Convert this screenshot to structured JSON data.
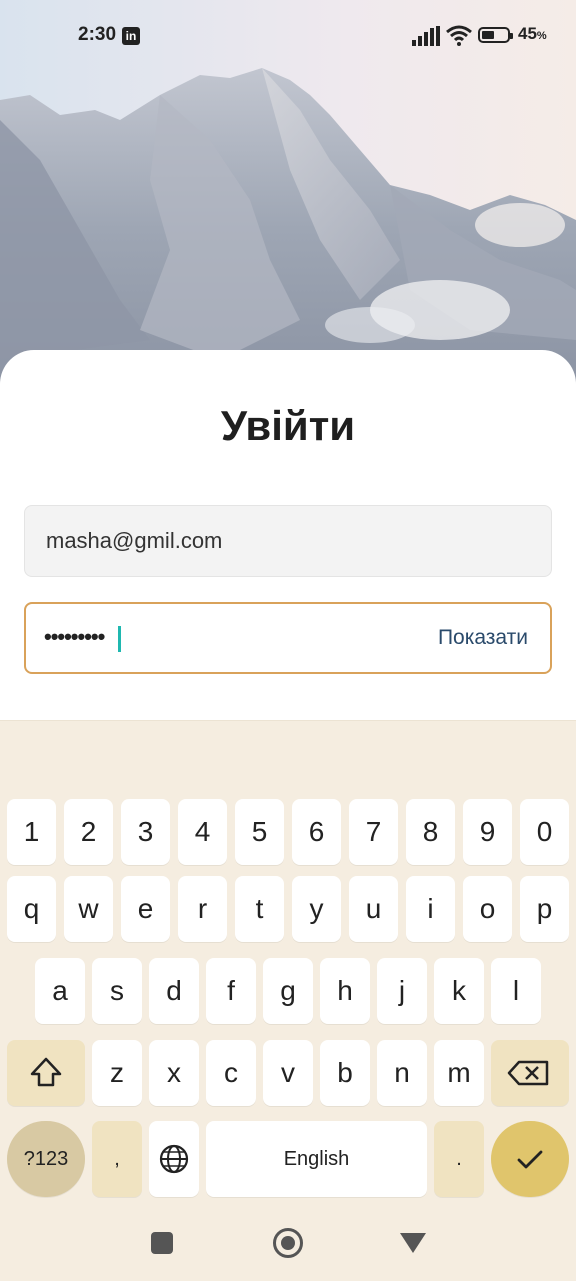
{
  "status_bar": {
    "time": "2:30",
    "app_icon": "linkedin-icon",
    "battery_percent": "45",
    "battery_unit": "%",
    "icons": [
      "signal-icon",
      "wifi-icon",
      "battery-icon"
    ]
  },
  "login": {
    "title": "Увійти",
    "email_value": "masha@gmil.com",
    "password_masked": "•••••••••",
    "show_password_label": "Показати"
  },
  "keyboard": {
    "row_numbers": [
      "1",
      "2",
      "3",
      "4",
      "5",
      "6",
      "7",
      "8",
      "9",
      "0"
    ],
    "row_top": [
      "q",
      "w",
      "e",
      "r",
      "t",
      "y",
      "u",
      "i",
      "o",
      "p"
    ],
    "row_middle": [
      "a",
      "s",
      "d",
      "f",
      "g",
      "h",
      "j",
      "k",
      "l"
    ],
    "row_bottom": [
      "z",
      "x",
      "c",
      "v",
      "b",
      "n",
      "m"
    ],
    "symbols_label": "?123",
    "comma_label": ",",
    "space_label": "English",
    "period_label": ".",
    "icons": [
      "shift-icon",
      "backspace-icon",
      "globe-icon",
      "enter-check-icon"
    ],
    "accent_color": "#e0c56c"
  },
  "navigation": {
    "icons": [
      "recent-apps-icon",
      "home-icon",
      "back-icon"
    ]
  }
}
